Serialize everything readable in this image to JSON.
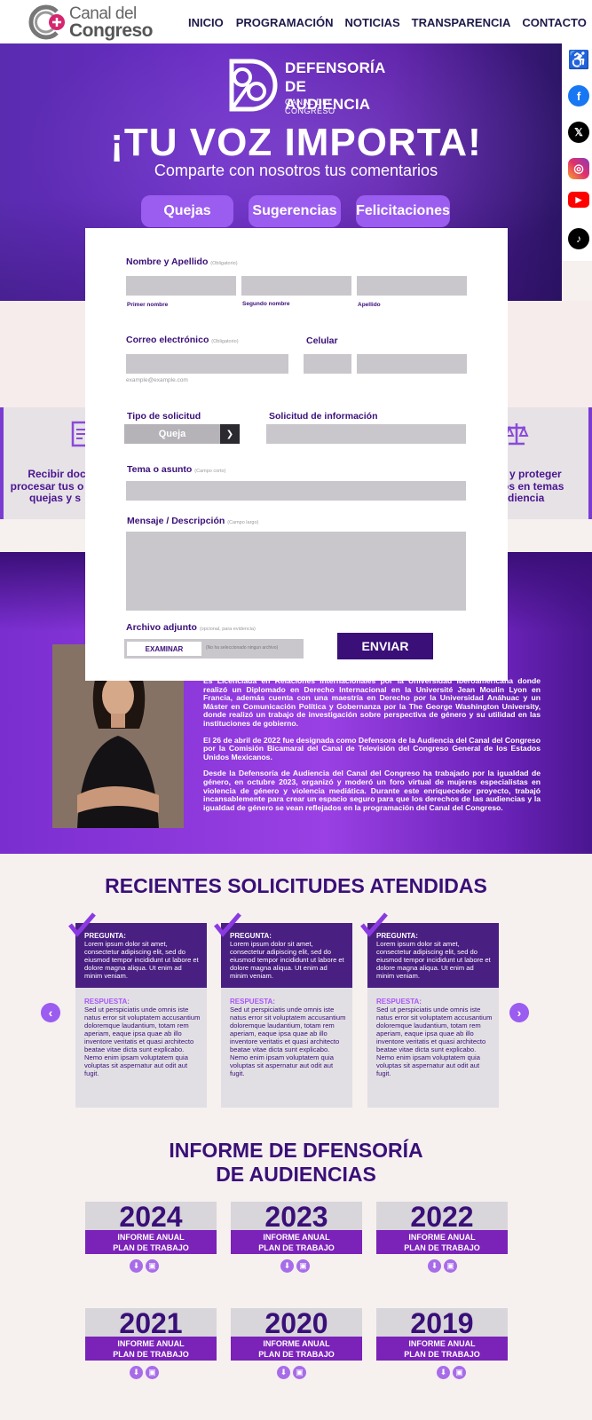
{
  "header": {
    "logo_line1": "Canal del",
    "logo_line2": "Congreso",
    "nav": [
      "INICIO",
      "PROGRAMACIÓN",
      "NOTICIAS",
      "TRANSPARENCIA",
      "CONTACTO"
    ]
  },
  "social": [
    "accessibility-icon",
    "facebook-icon",
    "x-icon",
    "instagram-icon",
    "youtube-icon",
    "tiktok-icon"
  ],
  "hero": {
    "logo_line1": "DEFENSORÍA",
    "logo_line2": "DE AUDIENCIA",
    "logo_line3": "CANAL DEL CONGRESO",
    "title": "¡TU VOZ IMPORTA!",
    "subtitle": "Comparte con nosotros tus comentarios",
    "tabs": [
      "Quejas",
      "Sugerencias",
      "Felicitaciones"
    ]
  },
  "form": {
    "name_label": "Nombre y Apellido",
    "required_hint": "(Obligatorio)",
    "first_name": "Primer nombre",
    "second_name": "Segundo nombre",
    "last_name": "Apellido",
    "email_label": "Correo electrónico",
    "email_placeholder": "example@example.com",
    "phone_label": "Celular",
    "type_label": "Tipo de solicitud",
    "type_value": "Queja",
    "info_label": "Solicitud de información",
    "topic_label": "Tema o asunto",
    "topic_hint": "(Campo corto)",
    "message_label": "Mensaje / Descripción",
    "message_hint": "(Campo largo)",
    "file_label": "Archivo adjunto",
    "file_hint": "(opcional, para evidencia)",
    "file_button": "EXAMINAR",
    "file_status": "(No ha seleccionado ningun archivo)",
    "send_button": "ENVIAR"
  },
  "band": {
    "left_text": [
      "Recibir doc",
      "procesar tus o",
      "quejas y s"
    ],
    "right_text": [
      "y proteger",
      "os en temas",
      "diencia"
    ]
  },
  "bio": {
    "paragraphs": [
      "Es Licenciada en Relaciones Internacionales por la Universidad Iberoamericana donde realizó un Diplomado en Derecho Internacional en la Université Jean Moulin Lyon en Francia, además cuenta con una maestría en Derecho por la Universidad Anáhuac y un Máster en Comunicación Política y Gobernanza por la The George Washington University, donde realizó un trabajo de investigación sobre perspectiva de género y su utilidad en las instituciones de gobierno.",
      "El 26 de abril de 2022 fue designada como Defensora de la Audiencia del Canal del Congreso por la Comisión Bicamaral del Canal de Televisión del Congreso General de los Estados Unidos Mexicanos.",
      "Desde la Defensoría de Audiencia del Canal del Congreso ha trabajado por la igualdad de género, en octubre 2023, organizó y moderó un foro virtual de mujeres especialistas en violencia de género y violencia mediática. Durante este enriquecedor proyecto, trabajó incansablemente para crear un espacio seguro para que los derechos de las audiencias y la igualdad de género se vean reflejados en la programación del Canal del Congreso."
    ]
  },
  "recent": {
    "title": "RECIENTES SOLICITUDES ATENDIDAS",
    "q_label": "PREGUNTA:",
    "a_label": "RESPUESTA:",
    "question": "Lorem ipsum dolor sit amet, consectetur adipiscing elit, sed do eiusmod tempor incididunt ut labore et dolore magna aliqua. Ut enim ad minim veniam.",
    "answer": "Sed ut perspiciatis unde omnis iste natus error sit voluptatem accusantium doloremque laudantium, totam rem aperiam, eaque ipsa quae ab illo inventore veritatis et quasi architecto beatae vitae dicta sunt explicabo. Nemo enim ipsam voluptatem quia voluptas sit aspernatur aut odit aut fugit.",
    "prev": "‹",
    "next": "›"
  },
  "reports": {
    "title_line1": "INFORME DE DFENSORÍA",
    "title_line2": "DE AUDIENCIAS",
    "label_line1": "INFORME ANUAL",
    "label_line2": "PLAN DE TRABAJO",
    "years": [
      "2024",
      "2023",
      "2022",
      "2021",
      "2020",
      "2019"
    ]
  }
}
